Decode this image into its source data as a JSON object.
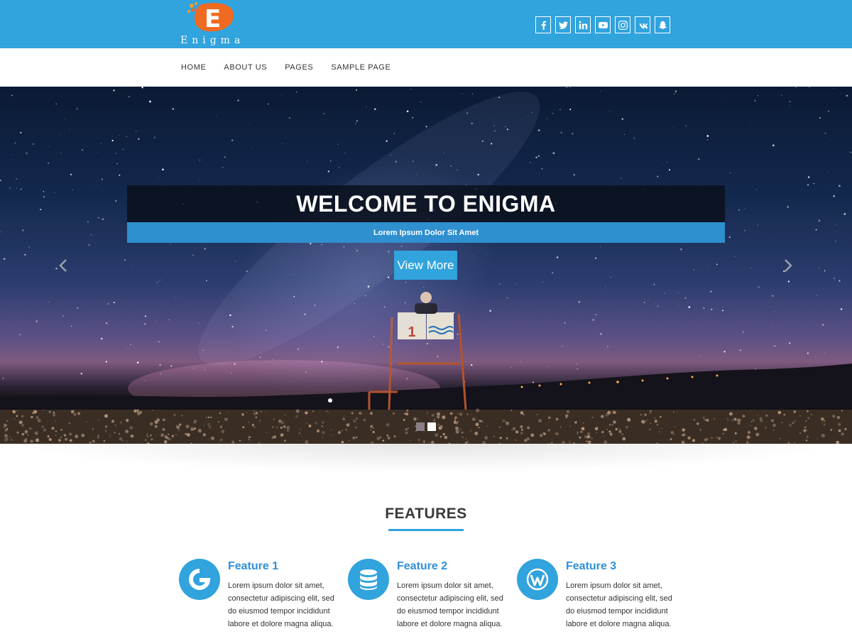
{
  "header": {
    "logo_text": "Enigma",
    "logo_letter": "E",
    "social_icons": [
      "facebook-icon",
      "twitter-icon",
      "linkedin-icon",
      "youtube-icon",
      "instagram-icon",
      "vk-icon",
      "snapchat-icon"
    ]
  },
  "nav": {
    "items": [
      {
        "label": "HOME"
      },
      {
        "label": "ABOUT US"
      },
      {
        "label": "PAGES"
      },
      {
        "label": "SAMPLE PAGE"
      }
    ]
  },
  "hero": {
    "title": "WELCOME TO ENIGMA",
    "subtitle": "Lorem Ipsum Dolor Sit Amet",
    "button_label": "View More",
    "prev_icon": "chevron-left-icon",
    "next_icon": "chevron-right-icon",
    "slide_count": 2,
    "active_slide": 2
  },
  "features": {
    "title": "FEATURES",
    "items": [
      {
        "title": "Feature 1",
        "icon": "google-icon",
        "text": "Lorem ipsum dolor sit amet, consectetur adipiscing elit, sed do eiusmod tempor incididunt labore et dolore magna aliqua."
      },
      {
        "title": "Feature 2",
        "icon": "database-icon",
        "text": "Lorem ipsum dolor sit amet, consectetur adipiscing elit, sed do eiusmod tempor incididunt labore et dolore magna aliqua."
      },
      {
        "title": "Feature 3",
        "icon": "wordpress-icon",
        "text": "Lorem ipsum dolor sit amet, consectetur adipiscing elit, sed do eiusmod tempor incididunt labore et dolore magna aliqua."
      }
    ]
  },
  "colors": {
    "accent": "#31a3dd",
    "subtitle_band": "#2f8fcf",
    "feature_title": "#2f8fd7",
    "logo_orange": "#f06a22"
  }
}
